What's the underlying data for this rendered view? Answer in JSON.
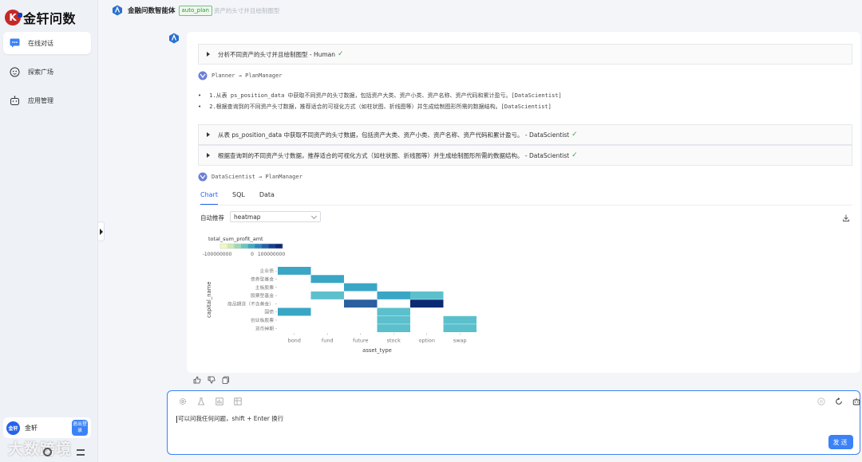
{
  "app": {
    "logo_text": "金轩问数"
  },
  "sidebar": {
    "items": [
      {
        "label": "在线对话",
        "icon": "chat-icon"
      },
      {
        "label": "探索广场",
        "icon": "compass-icon"
      },
      {
        "label": "应用管理",
        "icon": "robot-icon"
      }
    ],
    "user": {
      "avatar": "金轩",
      "name": "金轩",
      "logout": "退出登录"
    },
    "watermark": "大数跨境"
  },
  "header": {
    "agent_name": "金融问数智能体",
    "tag": "auto_plan",
    "subtitle": "资产的头寸并且绘制图型"
  },
  "message": {
    "tasks": [
      {
        "text": "分析不同资产的头寸并且绘制图型 - Human",
        "done": true
      }
    ],
    "route1": "Planner → PlanManager",
    "plan_steps": [
      "1.从表 ps_position_data 中获取不同资产的头寸数据，包括资产大类、资产小类、资产名称、资产代码和累计盈亏。[DataScientist]",
      "2.根据查询到的不同资产头寸数据，推荐适合的可视化方式（如柱状图、折线图等）并生成绘制图形所需的数据结构。[DataScientist]"
    ],
    "subtasks": [
      {
        "text": "从表 ps_position_data 中获取不同资产的头寸数据，包括资产大类、资产小类、资产名称、资产代码和累计盈亏。 - DataScientist"
      },
      {
        "text": "根据查询到的不同资产头寸数据，推荐适合的可视化方式（如柱状图、折线图等）并生成绘制图形所需的数据结构。 - DataScientist"
      }
    ],
    "route2": "DataScientist → PlanManager",
    "tabs": [
      "Chart",
      "SQL",
      "Data"
    ],
    "active_tab": "Chart",
    "recommend_label": "自动推荐",
    "chart_type_selected": "heatmap",
    "check_mark": "✓"
  },
  "chart_data": {
    "type": "heatmap",
    "legend_title": "total_sum_profit_amt",
    "legend_ticks": [
      "-100000000",
      "0",
      "100000000"
    ],
    "xlabel": "asset_type",
    "ylabel": "capital_name",
    "x_categories": [
      "bond",
      "fund",
      "future",
      "stock",
      "option",
      "swap"
    ],
    "y_categories": [
      "企业债",
      "债券型基金",
      "主板股票",
      "股票型基金",
      "商品期货（不含黄金）",
      "国债",
      "创业板股票",
      "货币掉期"
    ],
    "colors": {
      "light": "#5bc0cc",
      "mid": "#3aa6c5",
      "dark": "#2a5fa0",
      "darkest": "#0b2a74"
    },
    "cells": [
      {
        "x": "bond",
        "y": "企业债",
        "shade": "mid"
      },
      {
        "x": "bond",
        "y": "国债",
        "shade": "mid"
      },
      {
        "x": "fund",
        "y": "债券型基金",
        "shade": "mid"
      },
      {
        "x": "fund",
        "y": "股票型基金",
        "shade": "light"
      },
      {
        "x": "future",
        "y": "主板股票",
        "shade": "mid"
      },
      {
        "x": "future",
        "y": "商品期货（不含黄金）",
        "shade": "dark"
      },
      {
        "x": "stock",
        "y": "股票型基金",
        "shade": "mid"
      },
      {
        "x": "stock",
        "y": "国债",
        "shade": "light"
      },
      {
        "x": "stock",
        "y": "创业板股票",
        "shade": "light"
      },
      {
        "x": "stock",
        "y": "货币掉期",
        "shade": "light"
      },
      {
        "x": "option",
        "y": "股票型基金",
        "shade": "light"
      },
      {
        "x": "option",
        "y": "商品期货（不含黄金）",
        "shade": "darkest"
      },
      {
        "x": "swap",
        "y": "创业板股票",
        "shade": "light"
      },
      {
        "x": "swap",
        "y": "货币掉期",
        "shade": "light"
      }
    ]
  },
  "input": {
    "placeholder": "可以问我任何问题，shift + Enter 换行",
    "send_label": "发送"
  },
  "accent": "#3b82f6"
}
